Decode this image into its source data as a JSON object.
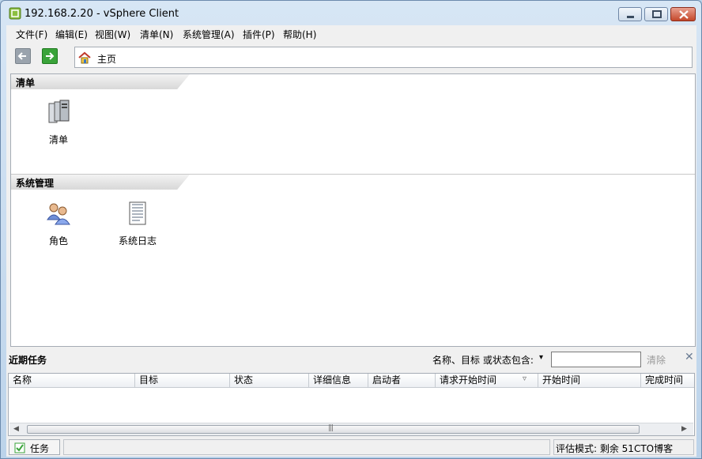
{
  "window": {
    "title": "192.168.2.20 - vSphere Client"
  },
  "menu": [
    "文件(F)",
    "编辑(E)",
    "视图(W)",
    "清单(N)",
    "系统管理(A)",
    "插件(P)",
    "帮助(H)"
  ],
  "address": {
    "text": "主页"
  },
  "sections": [
    {
      "title": "清单",
      "tiles": [
        {
          "label": "清单",
          "icon": "server-inventory-icon"
        }
      ]
    },
    {
      "title": "系统管理",
      "tiles": [
        {
          "label": "角色",
          "icon": "roles-users-icon"
        },
        {
          "label": "系统日志",
          "icon": "system-log-icon"
        }
      ]
    }
  ],
  "tasks": {
    "title": "近期任务",
    "filter_label": "名称、目标 或状态包含:",
    "filter_value": "",
    "clear_label": "清除",
    "columns": [
      "名称",
      "目标",
      "状态",
      "详细信息",
      "启动者",
      "请求开始时间",
      "开始时间",
      "完成时间"
    ]
  },
  "status": {
    "tasks_label": "任务",
    "eval_text": "评估模式: 剩余 51CTO博客"
  },
  "colors": {
    "accent": "#3aa33a",
    "titlebar": "#d7e6f5",
    "close": "#c4482b"
  }
}
